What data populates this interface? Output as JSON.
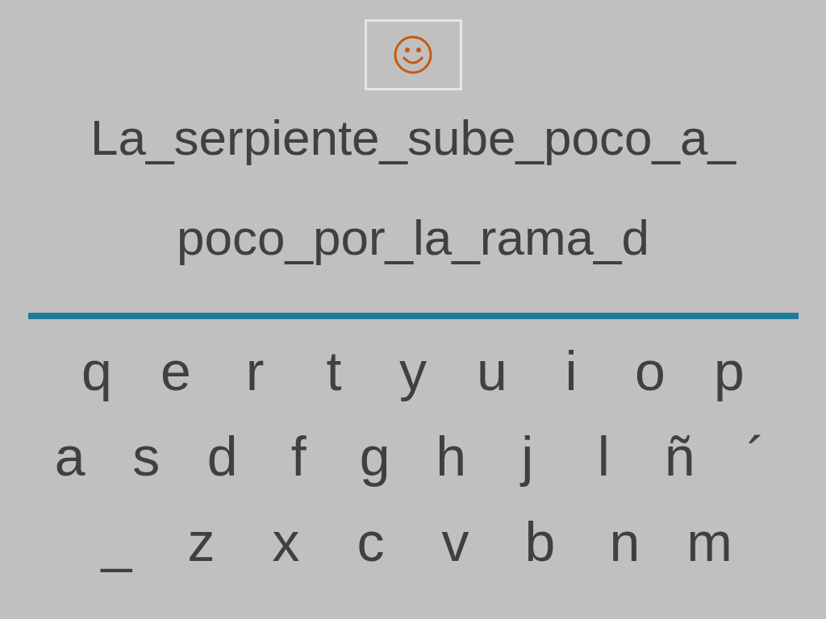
{
  "sentence_lines": [
    "La_serpiente_sube_poco_a_",
    "poco_por_la_rama_d"
  ],
  "keyboard": [
    [
      "q",
      "e",
      "r",
      "t",
      "y",
      "u",
      "i",
      "o",
      "p"
    ],
    [
      "a",
      "s",
      "d",
      "f",
      "g",
      "h",
      "j",
      "l",
      "ñ",
      "´"
    ],
    [
      "_",
      "z",
      "x",
      "c",
      "v",
      "b",
      "n",
      "m"
    ]
  ]
}
